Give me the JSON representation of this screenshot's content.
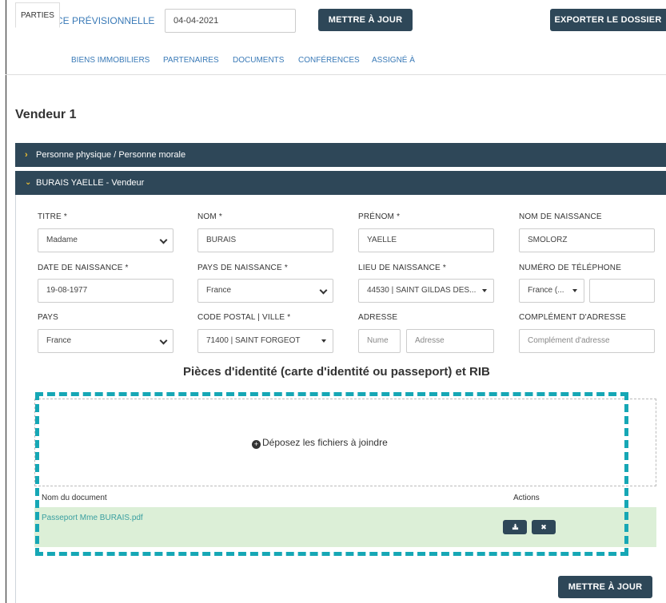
{
  "header": {
    "echeance_label": "ECHÉANCE PRÉVISIONNELLE",
    "echeance_value": "04-04-2021",
    "update_button": "METTRE À JOUR",
    "export_button": "EXPORTER LE DOSSIER"
  },
  "tabs": [
    {
      "label": "PARTIES",
      "active": true
    },
    {
      "label": "BIENS IMMOBILIERS"
    },
    {
      "label": "PARTENAIRES"
    },
    {
      "label": "DOCUMENTS"
    },
    {
      "label": "CONFÉRENCES"
    },
    {
      "label": "ASSIGNÉ À"
    }
  ],
  "section_title": "Vendeur 1",
  "accordions": [
    {
      "label": "Personne physique / Personne morale",
      "expanded": false
    },
    {
      "label": "BURAIS YAELLE - Vendeur",
      "expanded": true
    }
  ],
  "form": {
    "titre": {
      "label": "TITRE *",
      "value": "Madame"
    },
    "nom": {
      "label": "NOM *",
      "value": "BURAIS"
    },
    "prenom": {
      "label": "PRÉNOM *",
      "value": "YAELLE"
    },
    "nom_naissance": {
      "label": "NOM DE NAISSANCE",
      "value": "SMOLORZ"
    },
    "date_naissance": {
      "label": "DATE DE NAISSANCE *",
      "value": "19-08-1977"
    },
    "pays_naissance": {
      "label": "PAYS DE NAISSANCE *",
      "value": "France"
    },
    "lieu_naissance": {
      "label": "LIEU DE NAISSANCE *",
      "value": "44530 | SAINT GILDAS DES..."
    },
    "telephone": {
      "label": "NUMÉRO DE TÉLÉPHONE",
      "country": "France (...",
      "value": ""
    },
    "pays": {
      "label": "PAYS",
      "value": "France"
    },
    "code_postal": {
      "label": "CODE POSTAL | VILLE *",
      "value": "71400 | SAINT FORGEOT"
    },
    "adresse": {
      "label": "ADRESSE",
      "numero_placeholder": "Nume",
      "adresse_placeholder": "Adresse"
    },
    "complement": {
      "label": "COMPLÉMENT D'ADRESSE",
      "placeholder": "Complément d'adresse"
    }
  },
  "pieces": {
    "title": "Pièces d'identité (carte d'identité ou passeport) et RIB",
    "dropzone_text": "Déposez les fichiers à joindre",
    "col_document": "Nom du document",
    "col_actions": "Actions",
    "files": [
      {
        "name": "Passeport Mme BURAIS.pdf"
      }
    ]
  },
  "footer": {
    "update_button": "METTRE À JOUR"
  },
  "colors": {
    "dark": "#2e4758",
    "link": "#3a7ab7",
    "highlight": "#16a7b5",
    "file_row": "#dcefd7"
  }
}
